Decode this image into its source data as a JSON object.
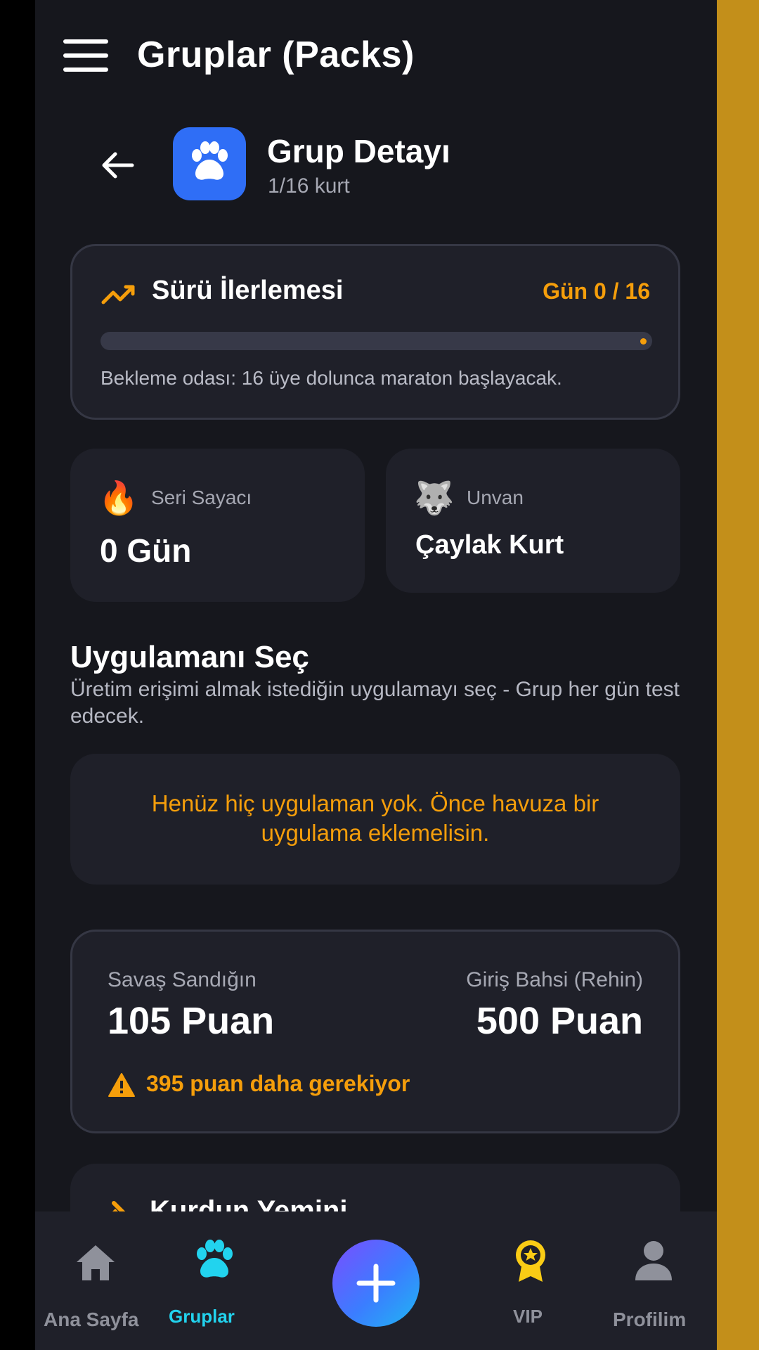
{
  "header": {
    "title": "Gruplar (Packs)"
  },
  "group": {
    "title": "Grup Detayı",
    "subtitle": "1/16 kurt"
  },
  "progress": {
    "title": "Sürü İlerlemesi",
    "day_label": "Gün 0 / 16",
    "value": 0,
    "note": "Bekleme odası: 16 üye dolunca maraton başlayacak."
  },
  "stats": {
    "streak": {
      "emoji": "🔥",
      "label": "Seri Sayacı",
      "value": "0 Gün"
    },
    "rank": {
      "emoji": "🐺",
      "label": "Unvan",
      "value": "Çaylak Kurt"
    }
  },
  "app_select": {
    "title": "Uygulamanı Seç",
    "description": "Üretim erişimi almak istediğin uygulamayı seç - Grup her gün test edecek.",
    "empty_message": "Henüz hiç uygulaman yok. Önce havuza bir uygulama eklemelisin."
  },
  "chest": {
    "left_label": "Savaş Sandığın",
    "left_value": "105 Puan",
    "right_label": "Giriş Bahsi (Rehin)",
    "right_value": "500 Puan",
    "warning": "395 puan daha gerekiyor"
  },
  "next_section": {
    "title": "Kurdun Yemini"
  },
  "bottom_nav": {
    "items": [
      {
        "label": "Ana Sayfa",
        "icon": "home-icon"
      },
      {
        "label": "Gruplar",
        "icon": "paw-icon"
      },
      {
        "label": "",
        "icon": "plus-icon"
      },
      {
        "label": "VIP",
        "icon": "vip-badge-icon"
      },
      {
        "label": "Profilim",
        "icon": "person-icon"
      }
    ]
  },
  "colors": {
    "accent": "#f59e0b",
    "background": "#16171d",
    "card": "#1f2029",
    "primary": "#2f6ef6",
    "active_nav": "#22d3ee",
    "vip": "#facc15"
  }
}
